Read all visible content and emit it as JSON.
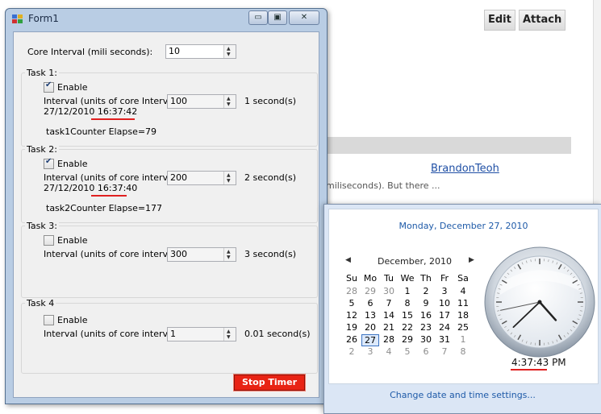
{
  "webpage": {
    "edit_label": "Edit",
    "attach_label": "Attach",
    "author_link": "BrandonTeoh",
    "snippet": "miliseconds). But there ..."
  },
  "form": {
    "title": "Form1",
    "caption_minimize": "▭",
    "caption_maximize": "▣",
    "caption_close": "✕",
    "core_interval_label": "Core Interval (mili seconds):",
    "core_interval_value": "10",
    "tasks": [
      {
        "title": "Task 1:",
        "enable_label": "Enable",
        "enabled": true,
        "interval_label": "Interval (units of core Interval):",
        "timestamp": "27/12/2010 16:37:42",
        "interval_value": "100",
        "seconds_text": "1 second(s)",
        "counter_text": "task1Counter Elapse=79"
      },
      {
        "title": "Task 2:",
        "enable_label": "Enable",
        "enabled": true,
        "interval_label": "Interval (units of core interval):",
        "timestamp": "27/12/2010 16:37:40",
        "interval_value": "200",
        "seconds_text": "2 second(s)",
        "counter_text": "task2Counter Elapse=177"
      },
      {
        "title": "Task 3:",
        "enable_label": "Enable",
        "enabled": false,
        "interval_label": "Interval (units of core interval):",
        "interval_value": "300",
        "seconds_text": "3 second(s)"
      },
      {
        "title": "Task 4",
        "enable_label": "Enable",
        "enabled": false,
        "interval_label": "Interval (units of core interval):",
        "interval_value": "1",
        "seconds_text": "0.01 second(s)"
      }
    ],
    "stop_button_label": "Stop Timer"
  },
  "clock": {
    "long_date": "Monday, December 27, 2010",
    "month_label": "December, 2010",
    "weekdays": [
      "Su",
      "Mo",
      "Tu",
      "We",
      "Th",
      "Fr",
      "Sa"
    ],
    "weeks": [
      [
        "28",
        "29",
        "30",
        "1",
        "2",
        "3",
        "4"
      ],
      [
        "5",
        "6",
        "7",
        "8",
        "9",
        "10",
        "11"
      ],
      [
        "12",
        "13",
        "14",
        "15",
        "16",
        "17",
        "18"
      ],
      [
        "19",
        "20",
        "21",
        "22",
        "23",
        "24",
        "25"
      ],
      [
        "26",
        "27",
        "28",
        "29",
        "30",
        "31",
        "1"
      ],
      [
        "2",
        "3",
        "4",
        "5",
        "6",
        "7",
        "8"
      ]
    ],
    "today": "27",
    "time_text": "4:37:43 PM",
    "hour": 4,
    "minute": 37,
    "second": 43,
    "settings_link": "Change date and time settings...",
    "accent_color": "#1e5aa8",
    "stop_button_color": "#e82314"
  }
}
